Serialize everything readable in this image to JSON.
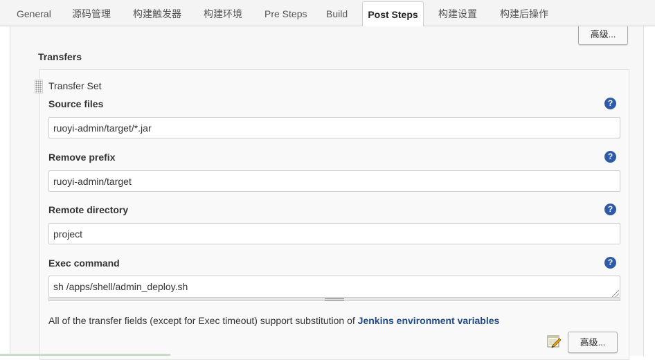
{
  "tabs": [
    {
      "label": "General",
      "active": false
    },
    {
      "label": "源码管理",
      "active": false
    },
    {
      "label": "构建触发器",
      "active": false
    },
    {
      "label": "构建环境",
      "active": false
    },
    {
      "label": "Pre Steps",
      "active": false
    },
    {
      "label": "Build",
      "active": false
    },
    {
      "label": "Post Steps",
      "active": true
    },
    {
      "label": "构建设置",
      "active": false
    },
    {
      "label": "构建后操作",
      "active": false
    }
  ],
  "top_advanced_button": "高级...",
  "transfers": {
    "title": "Transfers",
    "set_title": "Transfer Set",
    "fields": {
      "source_files": {
        "label": "Source files",
        "value": "ruoyi-admin/target/*.jar"
      },
      "remove_prefix": {
        "label": "Remove prefix",
        "value": "ruoyi-admin/target"
      },
      "remote_directory": {
        "label": "Remote directory",
        "value": "project"
      },
      "exec_command": {
        "label": "Exec command",
        "value": "sh /apps/shell/admin_deploy.sh"
      }
    },
    "help_glyph": "?",
    "note": {
      "text": "All of the transfer fields (except for Exec timeout) support substitution of ",
      "link": "Jenkins environment variables"
    },
    "advanced_button": "高级..."
  },
  "icons": {
    "help": "help-question-icon",
    "notepad": "notepad-pencil-icon",
    "drag": "drag-handle-icon"
  },
  "colors": {
    "accent_link": "#204a87",
    "help_icon": "#2f5aa8",
    "panel_bg": "#f7f7f7",
    "tab_bar_bg": "#f4f4f4"
  }
}
